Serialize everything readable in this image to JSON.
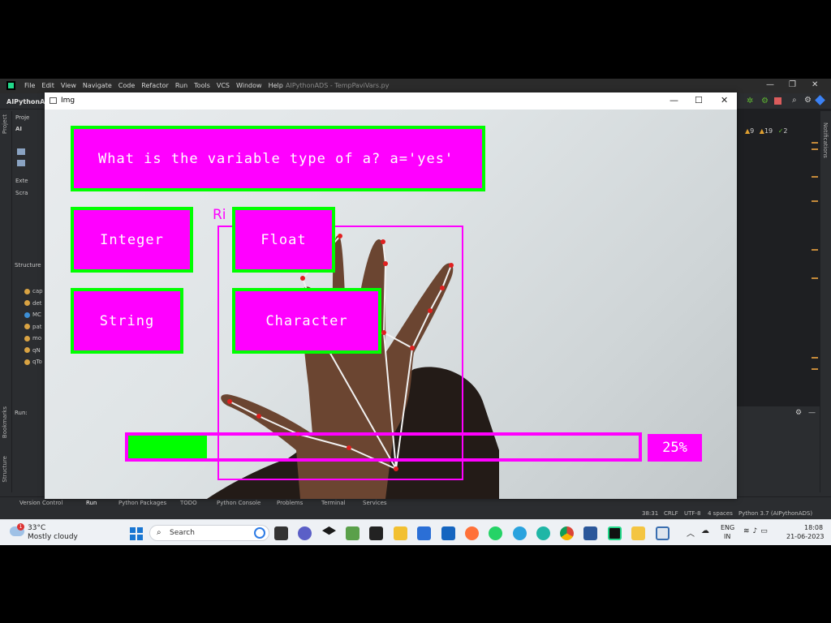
{
  "ide": {
    "menu": [
      "File",
      "Edit",
      "View",
      "Navigate",
      "Code",
      "Refactor",
      "Run",
      "Tools",
      "VCS",
      "Window",
      "Help"
    ],
    "filename": "AIPythonADS - TempPaviVars.py",
    "project_name": "AIPythonADS",
    "tree": [
      "Proje",
      "AI",
      "Exte",
      "Scra"
    ],
    "structure_label": "Structure",
    "structure_items": [
      "cap",
      "det",
      "MC",
      "pat",
      "mo",
      "qN",
      "qTo"
    ],
    "inspection": {
      "warnings": "9",
      "weak": "19",
      "ok": "2"
    },
    "run_label": "Run:",
    "left_tabs": [
      "Project",
      "Bookmarks",
      "Structure"
    ],
    "bottom_tabs": [
      "Version Control",
      "Run",
      "Python Packages",
      "TODO",
      "Python Console",
      "Problems",
      "Terminal",
      "Services"
    ],
    "status": {
      "position": "38:31",
      "line_sep": "CRLF",
      "encoding": "UTF-8",
      "indent": "4 spaces",
      "interpreter": "Python 3.7 (AIPythonADS)"
    },
    "notifications_label": "Notifications"
  },
  "img_window": {
    "title": "Img",
    "minimize": "—",
    "maximize": "☐",
    "close": "✕"
  },
  "quiz": {
    "question": "What is the variable type of a? a='yes'",
    "options": [
      "Integer",
      "Float",
      "String",
      "Character"
    ],
    "hand_label": "Ri",
    "progress_percent": 25,
    "progress_label": "25%"
  },
  "colors": {
    "box": "#ff00ff",
    "border": "#00ff00",
    "progress": "#00ff00"
  },
  "taskbar": {
    "weather_temp": "33°C",
    "weather_desc": "Mostly cloudy",
    "weather_badge": "1",
    "search_placeholder": "Search",
    "apps": [
      "task-view",
      "widgets",
      "dropbox",
      "photos",
      "amazon",
      "file-explorer",
      "store",
      "mail",
      "firefox",
      "whatsapp",
      "telegram",
      "edge",
      "chrome",
      "word",
      "pycharm",
      "files",
      "img-app"
    ],
    "lang1": "ENG",
    "lang2": "IN",
    "time": "18:08",
    "date": "21-06-2023"
  }
}
